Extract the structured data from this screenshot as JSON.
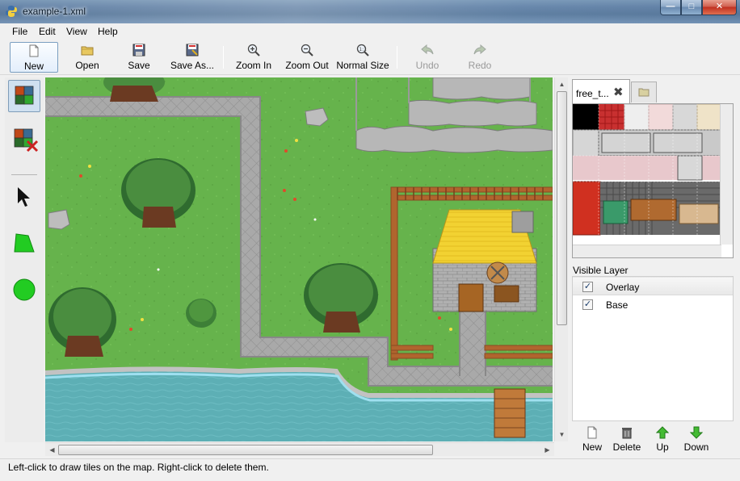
{
  "window": {
    "title": "example-1.xml",
    "min": "—",
    "max": "□",
    "close": "✕"
  },
  "menu": [
    "File",
    "Edit",
    "View",
    "Help"
  ],
  "toolbar": {
    "new": "New",
    "open": "Open",
    "save": "Save",
    "save_as": "Save As...",
    "zoom_in": "Zoom In",
    "zoom_out": "Zoom Out",
    "normal_size": "Normal Size",
    "undo": "Undo",
    "redo": "Redo"
  },
  "palette": {
    "tools": [
      "draw-tiles",
      "erase-tiles",
      "select",
      "polygon",
      "circle"
    ],
    "colors": {
      "polygon": "#22cc22",
      "circle": "#22cc22",
      "erase": "#cc2222"
    }
  },
  "tileset": {
    "tab_label": "free_t...",
    "tab_close": "✖"
  },
  "layers": {
    "title": "Visible Layer",
    "items": [
      {
        "name": "Overlay",
        "visible": true,
        "selected": true
      },
      {
        "name": "Base",
        "visible": true,
        "selected": false
      }
    ],
    "check": "✓",
    "tools": {
      "new": "New",
      "delete": "Delete",
      "up": "Up",
      "down": "Down"
    }
  },
  "status": "Left-click to draw tiles on the map. Right-click to delete them."
}
